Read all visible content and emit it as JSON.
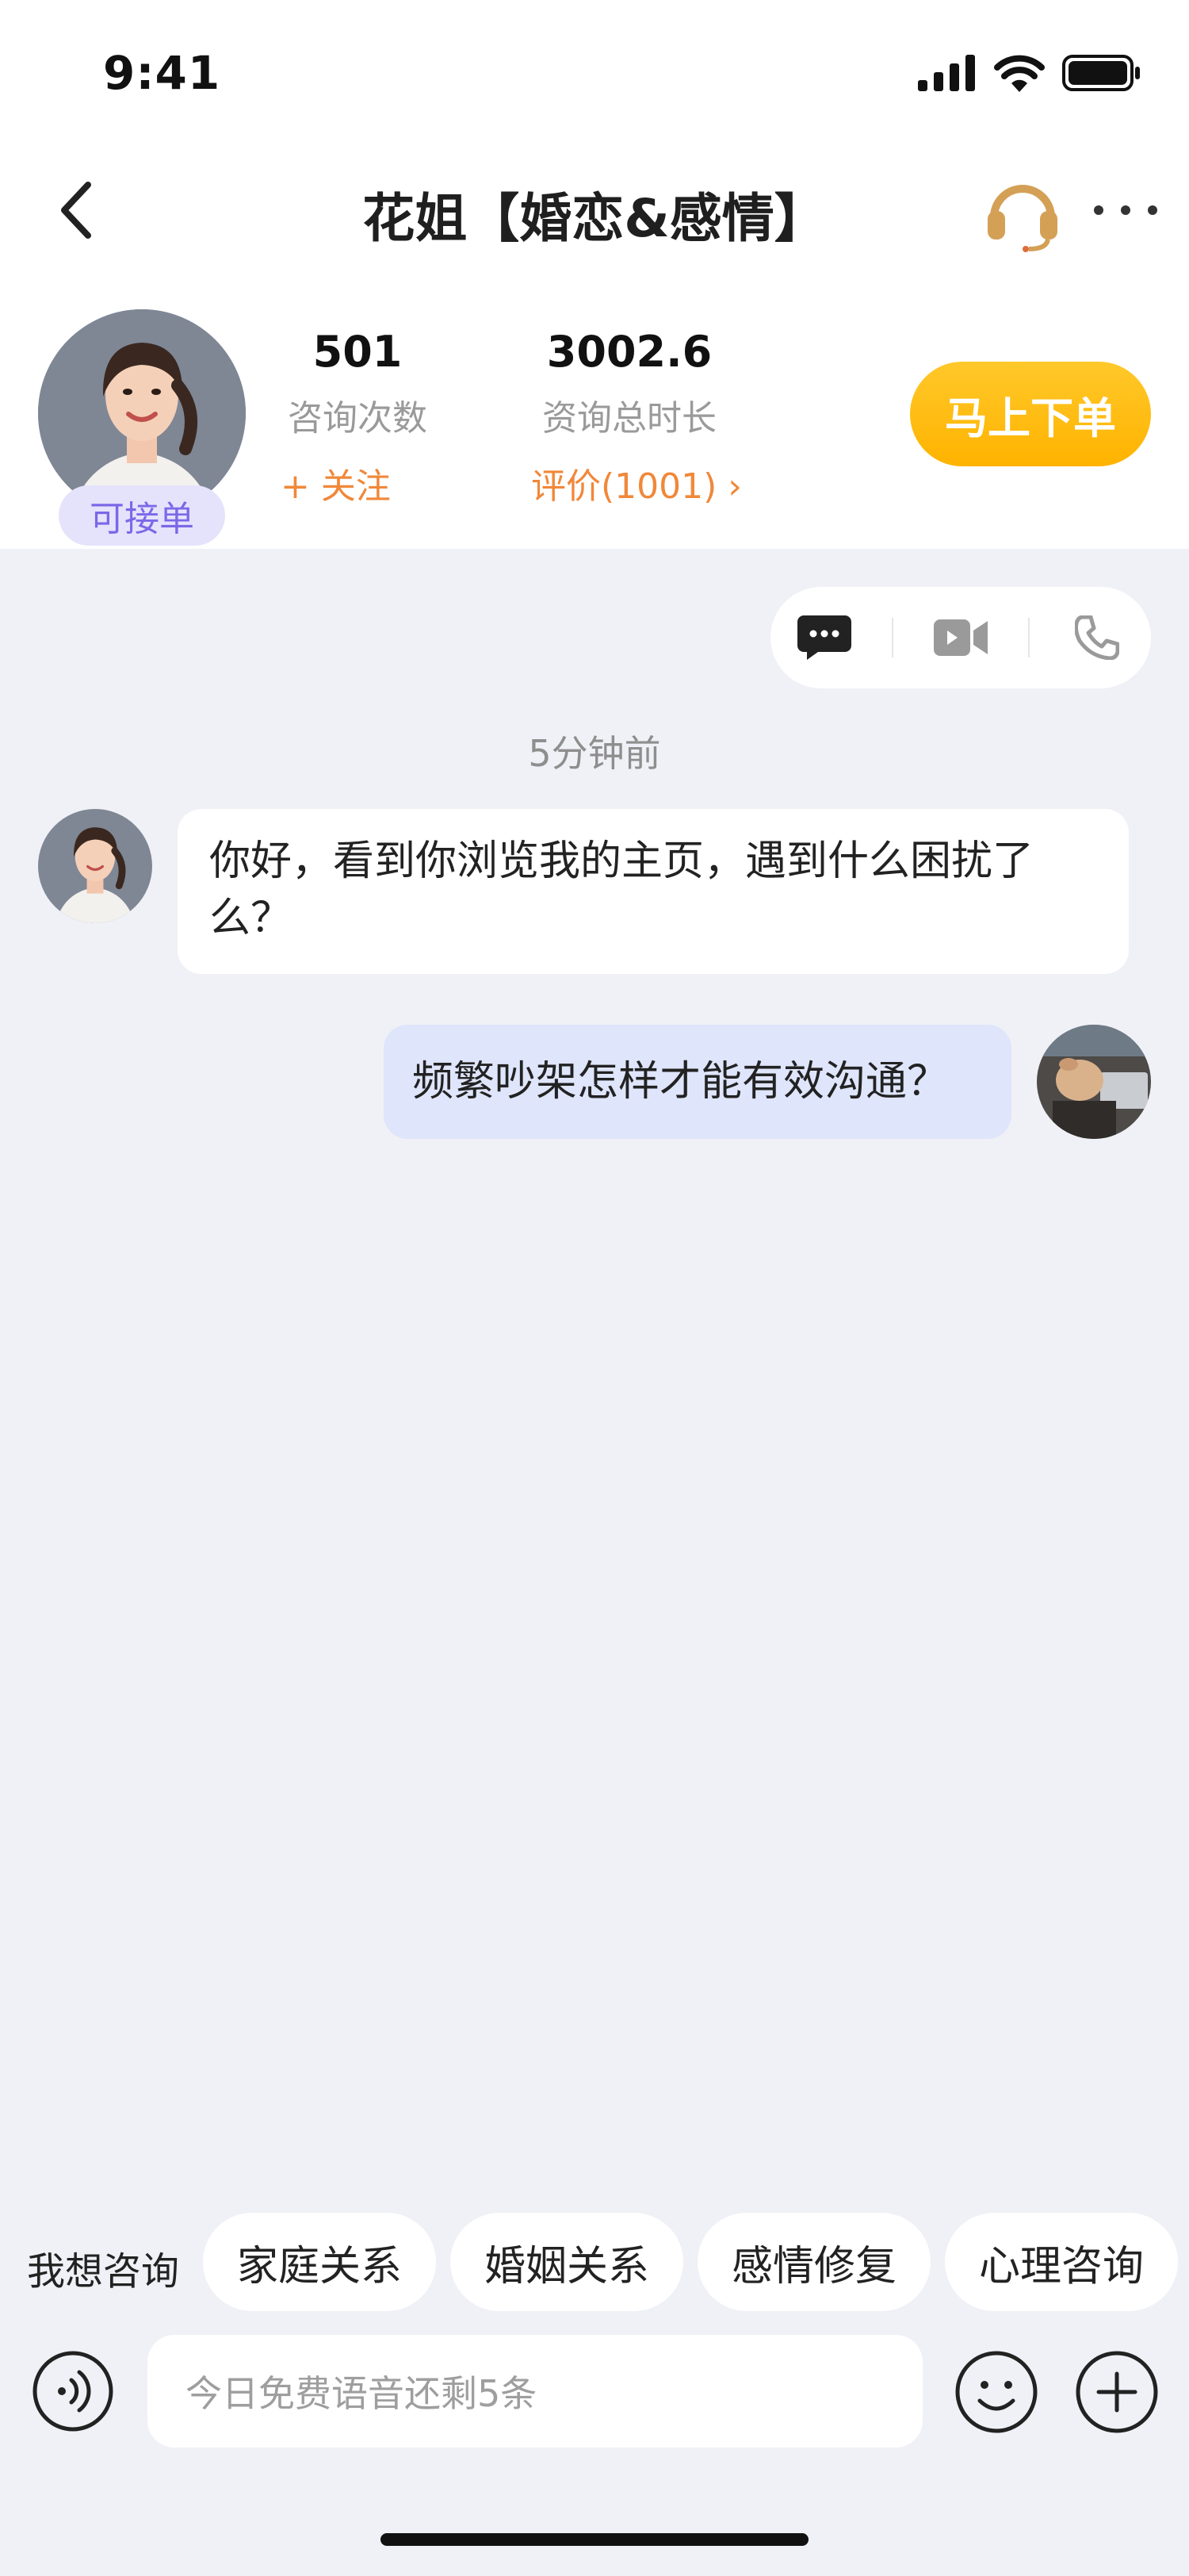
{
  "status_bar": {
    "time": "9:41",
    "icons": [
      "cellular-signal-icon",
      "wifi-icon",
      "battery-icon"
    ]
  },
  "nav": {
    "back_icon": "chevron-left-icon",
    "title": "花姐【婚恋&感情】",
    "headset_icon": "headset-icon",
    "more_icon": "more-dots-icon"
  },
  "profile": {
    "availability_badge": "可接单",
    "consult_count": {
      "value": "501",
      "label": "咨询次数",
      "action": "+ 关注"
    },
    "consult_duration": {
      "value": "3002.6",
      "label": "资询总时长",
      "action": "评价(1001) ›"
    },
    "order_button": "马上下单"
  },
  "mode_switch": {
    "items": [
      "chat-bubble-icon",
      "video-camera-icon",
      "phone-icon"
    ],
    "active": "chat-bubble-icon"
  },
  "conversation": {
    "timestamp": "5分钟前",
    "messages": [
      {
        "from": "consultant",
        "text": "你好，看到你浏览我的主页，遇到什么困扰了么？"
      },
      {
        "from": "user",
        "text": "频繁吵架怎样才能有效沟通？"
      }
    ]
  },
  "quick_topics": {
    "label": "我想咨询",
    "chips": [
      "家庭关系",
      "婚姻关系",
      "感情修复",
      "心理咨询"
    ]
  },
  "input_bar": {
    "placeholder": "今日免费语音还剩5条",
    "voice_icon": "voice-wave-icon",
    "emoji_icon": "smiley-face-icon",
    "plus_icon": "plus-circle-icon"
  },
  "colors": {
    "accent_orange": "#F0883A",
    "order_button": "#FFB300",
    "headset_gold": "#D4A056",
    "badge_purple": "#7A68E8",
    "user_bubble": "#DFE5FB",
    "page_bg": "#F0F1F6"
  }
}
